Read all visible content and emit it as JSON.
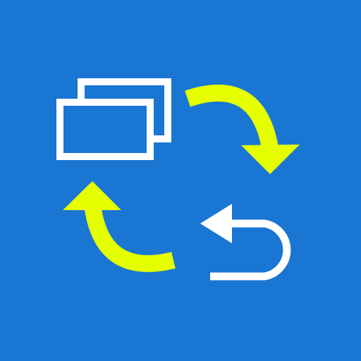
{
  "icon": {
    "kind": "app-icon",
    "background_color": "#1976D2",
    "accent_color": "#E6FF00",
    "foreground_color": "#FFFFFF",
    "glyphs": [
      "stacked-windows-icon",
      "clockwise-arrow-icon",
      "counterclockwise-arrow-icon",
      "back-arrow-icon"
    ]
  }
}
